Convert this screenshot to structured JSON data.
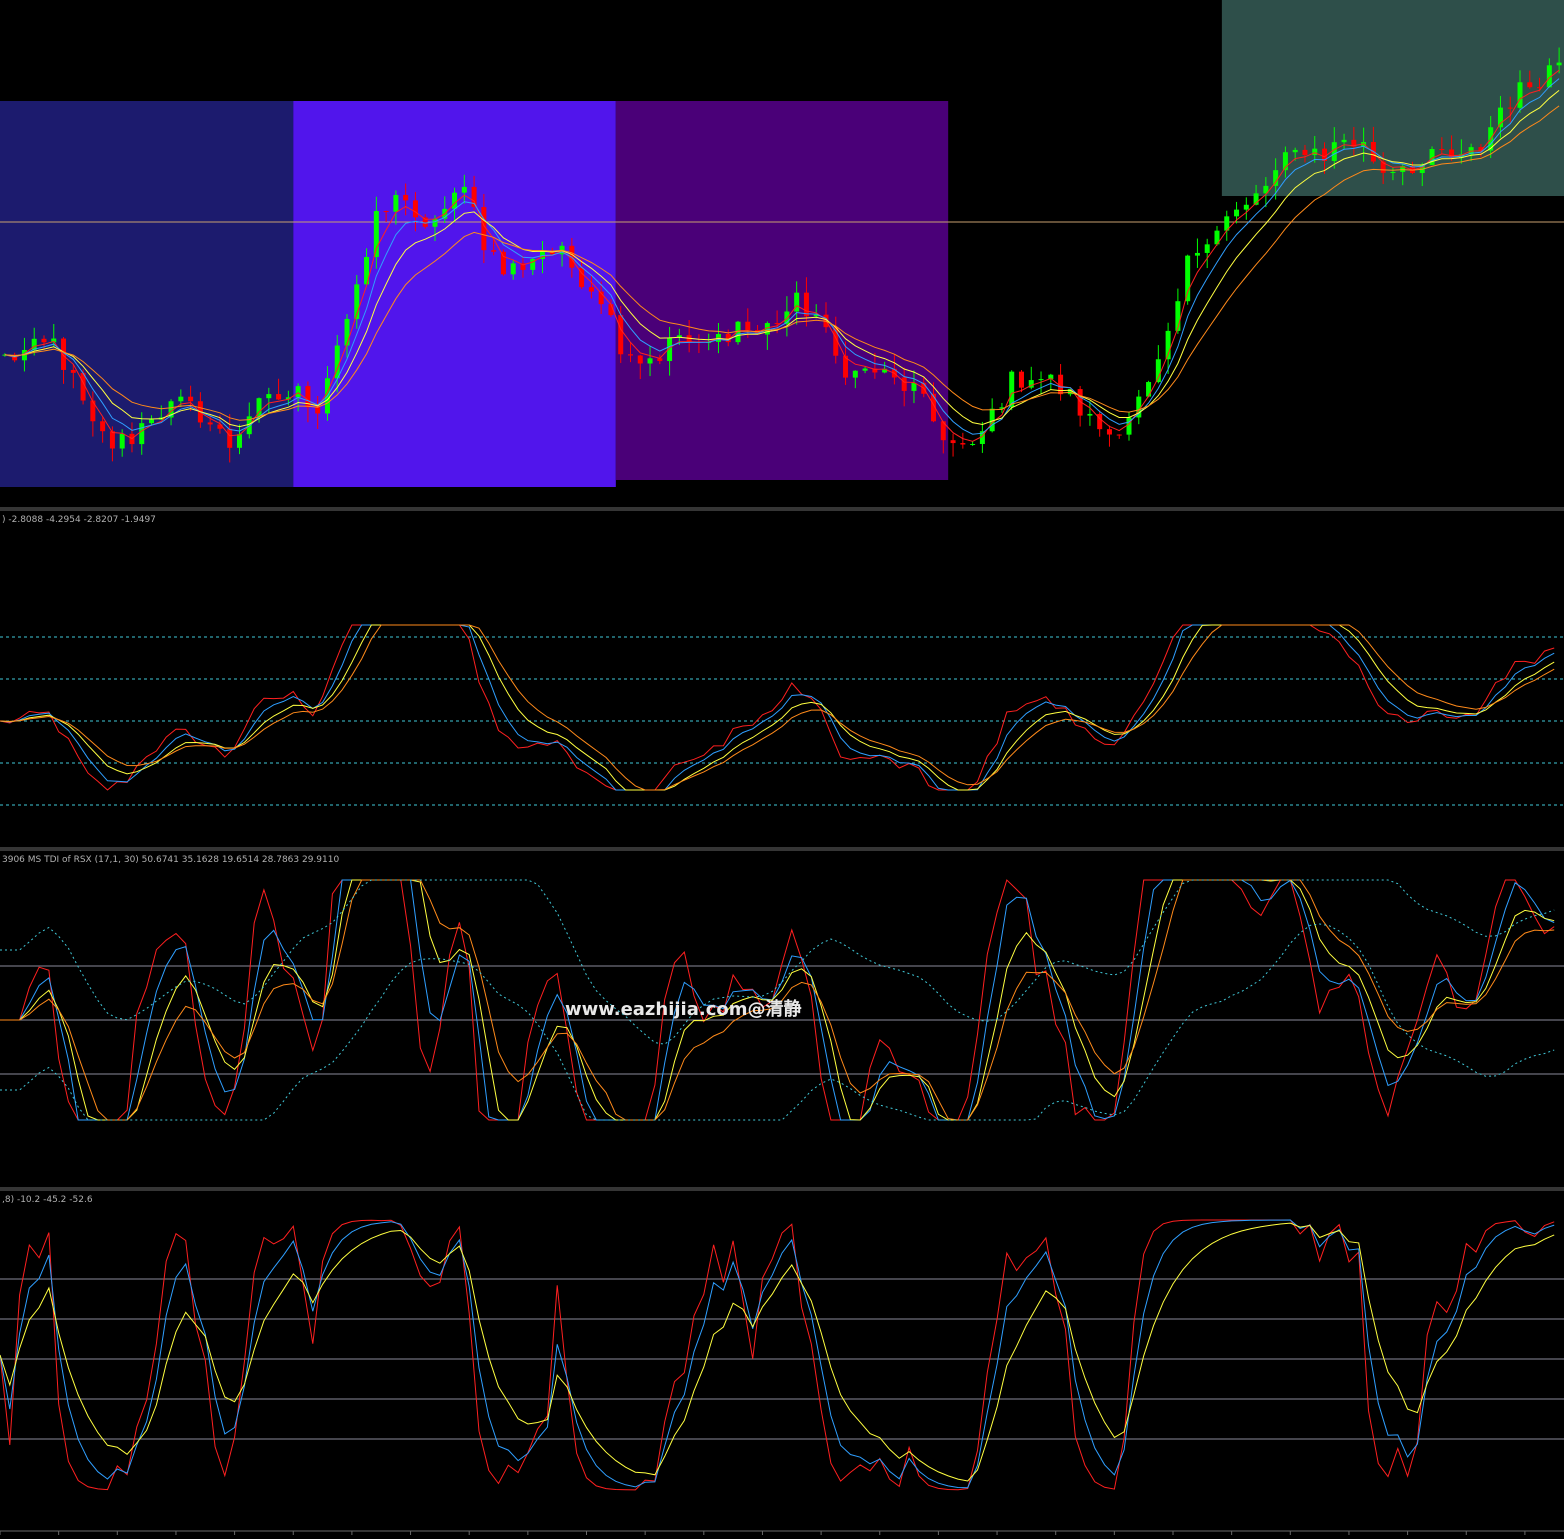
{
  "colors": {
    "background": "#000000",
    "zone_1": "#1c1b6e",
    "zone_2": "#5115ec",
    "zone_3": "#4a0078",
    "zone_4": "#2e4f4a",
    "bull": "#00ff00",
    "bear": "#ff0000",
    "ma_red": "#ff2020",
    "ma_blue": "#2f9fff",
    "ma_yellow": "#ffff40",
    "ma_orange": "#ff8a1a",
    "level_cyan": "#40c8d8",
    "level_gray": "#8a8a9a",
    "hline_tan": "#c8a070",
    "separator": "#6a6a6a"
  },
  "watermark": "www.eazhijia.com@清静",
  "indicator_labels": {
    "panel_1": ") -2.8088 -4.2954 -2.8207 -1.9497",
    "panel_2": "3906  MS TDI of RSX  (17,1, 30) 50.6741 35.1628 19.6514 28.7863 29.9110",
    "panel_3": ",8) -10.2 -45.2 -52.6"
  },
  "chart_data": [
    {
      "type": "candlestick",
      "panel": "price",
      "bars": 160,
      "series": [
        {
          "name": "",
          "color": "red",
          "kind": "moving-average"
        },
        {
          "name": "",
          "color": "blue",
          "kind": "moving-average"
        },
        {
          "name": "",
          "color": "yellow",
          "kind": "moving-average"
        },
        {
          "name": "",
          "color": "orange",
          "kind": "moving-average"
        }
      ],
      "close_profile_norm": [
        [
          0,
          0.36
        ],
        [
          3,
          0.38
        ],
        [
          5,
          0.4
        ],
        [
          7,
          0.3
        ],
        [
          9,
          0.18
        ],
        [
          11,
          0.14
        ],
        [
          13,
          0.16
        ],
        [
          15,
          0.22
        ],
        [
          18,
          0.24
        ],
        [
          20,
          0.22
        ],
        [
          23,
          0.14
        ],
        [
          25,
          0.22
        ],
        [
          28,
          0.26
        ],
        [
          30,
          0.27
        ],
        [
          32,
          0.24
        ],
        [
          34,
          0.4
        ],
        [
          36,
          0.52
        ],
        [
          38,
          0.72
        ],
        [
          40,
          0.78
        ],
        [
          42,
          0.7
        ],
        [
          45,
          0.72
        ],
        [
          47,
          0.82
        ],
        [
          49,
          0.66
        ],
        [
          51,
          0.58
        ],
        [
          53,
          0.6
        ],
        [
          55,
          0.64
        ],
        [
          57,
          0.62
        ],
        [
          59,
          0.57
        ],
        [
          61,
          0.52
        ],
        [
          63,
          0.4
        ],
        [
          65,
          0.36
        ],
        [
          67,
          0.37
        ],
        [
          69,
          0.42
        ],
        [
          71,
          0.38
        ],
        [
          73,
          0.41
        ],
        [
          75,
          0.45
        ],
        [
          77,
          0.42
        ],
        [
          79,
          0.46
        ],
        [
          81,
          0.5
        ],
        [
          83,
          0.47
        ],
        [
          85,
          0.36
        ],
        [
          87,
          0.32
        ],
        [
          89,
          0.33
        ],
        [
          91,
          0.3
        ],
        [
          93,
          0.28
        ],
        [
          95,
          0.2
        ],
        [
          97,
          0.14
        ],
        [
          99,
          0.12
        ],
        [
          101,
          0.22
        ],
        [
          103,
          0.3
        ],
        [
          105,
          0.32
        ],
        [
          107,
          0.3
        ],
        [
          109,
          0.26
        ],
        [
          111,
          0.2
        ],
        [
          113,
          0.17
        ],
        [
          115,
          0.22
        ],
        [
          117,
          0.28
        ],
        [
          119,
          0.4
        ],
        [
          121,
          0.6
        ],
        [
          123,
          0.68
        ],
        [
          125,
          0.72
        ],
        [
          127,
          0.74
        ],
        [
          129,
          0.8
        ],
        [
          131,
          0.86
        ],
        [
          133,
          0.9
        ],
        [
          135,
          0.88
        ],
        [
          137,
          0.92
        ],
        [
          139,
          0.9
        ],
        [
          141,
          0.84
        ],
        [
          143,
          0.86
        ],
        [
          145,
          0.85
        ],
        [
          147,
          0.88
        ],
        [
          149,
          0.86
        ],
        [
          151,
          0.9
        ],
        [
          153,
          1.0
        ],
        [
          155,
          1.04
        ],
        [
          157,
          1.08
        ],
        [
          159,
          1.12
        ]
      ],
      "zones": [
        {
          "from_bar": 0,
          "to_bar": 30,
          "color": "zone_1"
        },
        {
          "from_bar": 30,
          "to_bar": 63,
          "color": "zone_2"
        },
        {
          "from_bar": 63,
          "to_bar": 97,
          "color": "zone_3"
        },
        {
          "from_bar": 125,
          "to_bar": 160,
          "color": "zone_4"
        }
      ]
    },
    {
      "type": "line",
      "panel": "oscillator-1",
      "levels_dashed": 5,
      "series": [
        {
          "name": "",
          "color": "red"
        },
        {
          "name": "",
          "color": "blue"
        },
        {
          "name": "",
          "color": "yellow"
        },
        {
          "name": "",
          "color": "orange"
        }
      ]
    },
    {
      "type": "line",
      "panel": "MS TDI of RSX",
      "series": [
        {
          "name": "",
          "color": "red"
        },
        {
          "name": "",
          "color": "blue"
        },
        {
          "name": "",
          "color": "yellow"
        },
        {
          "name": "",
          "color": "orange"
        },
        {
          "name": "",
          "color": "cyan-dashed-upper"
        },
        {
          "name": "",
          "color": "cyan-dashed-lower"
        }
      ]
    },
    {
      "type": "line",
      "panel": "oscillator-3",
      "series": [
        {
          "name": "",
          "color": "red"
        },
        {
          "name": "",
          "color": "blue"
        },
        {
          "name": "",
          "color": "yellow"
        }
      ]
    }
  ]
}
